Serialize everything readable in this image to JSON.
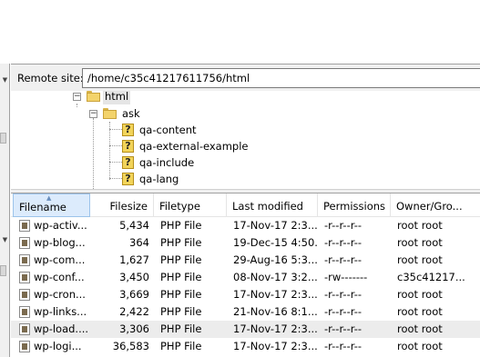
{
  "remote_site": {
    "label": "Remote site:",
    "path": "/home/c35c41217611756/html"
  },
  "tree": {
    "root": {
      "label": "html",
      "icon": "folder-open-icon"
    },
    "child": {
      "label": "ask",
      "icon": "folder-open-icon"
    },
    "items": [
      {
        "label": "qa-content",
        "icon": "unknown-folder-icon"
      },
      {
        "label": "qa-external-example",
        "icon": "unknown-folder-icon"
      },
      {
        "label": "qa-include",
        "icon": "unknown-folder-icon"
      },
      {
        "label": "qa-lang",
        "icon": "unknown-folder-icon"
      }
    ]
  },
  "file_list": {
    "columns": {
      "filename": "Filename",
      "filesize": "Filesize",
      "filetype": "Filetype",
      "last_modified": "Last modified",
      "permissions": "Permissions",
      "owner_group": "Owner/Gro..."
    },
    "sort_column": "Filename",
    "rows": [
      {
        "name": "wp-activ...",
        "size": "5,434",
        "type": "PHP File",
        "modified": "17-Nov-17 2:3...",
        "perms": "-r--r--r--",
        "owner": "root root",
        "selected": false
      },
      {
        "name": "wp-blog...",
        "size": "364",
        "type": "PHP File",
        "modified": "19-Dec-15 4:50...",
        "perms": "-r--r--r--",
        "owner": "root root",
        "selected": false
      },
      {
        "name": "wp-com...",
        "size": "1,627",
        "type": "PHP File",
        "modified": "29-Aug-16 5:3...",
        "perms": "-r--r--r--",
        "owner": "root root",
        "selected": false
      },
      {
        "name": "wp-conf...",
        "size": "3,450",
        "type": "PHP File",
        "modified": "08-Nov-17 3:2...",
        "perms": "-rw-------",
        "owner": "c35c41217...",
        "selected": false
      },
      {
        "name": "wp-cron...",
        "size": "3,669",
        "type": "PHP File",
        "modified": "17-Nov-17 2:3...",
        "perms": "-r--r--r--",
        "owner": "root root",
        "selected": false
      },
      {
        "name": "wp-links...",
        "size": "2,422",
        "type": "PHP File",
        "modified": "21-Nov-16 8:1...",
        "perms": "-r--r--r--",
        "owner": "root root",
        "selected": false
      },
      {
        "name": "wp-load....",
        "size": "3,306",
        "type": "PHP File",
        "modified": "17-Nov-17 2:3...",
        "perms": "-r--r--r--",
        "owner": "root root",
        "selected": true
      },
      {
        "name": "wp-logi...",
        "size": "36,583",
        "type": "PHP File",
        "modified": "17-Nov-17 2:3...",
        "perms": "-r--r--r--",
        "owner": "root root",
        "selected": false
      }
    ]
  },
  "colors": {
    "panel_bg": "#f0f0f0",
    "sorted_header_bg": "#dcebfc",
    "selected_row_bg": "#ececec",
    "folder_yellow": "#f3d36b"
  }
}
